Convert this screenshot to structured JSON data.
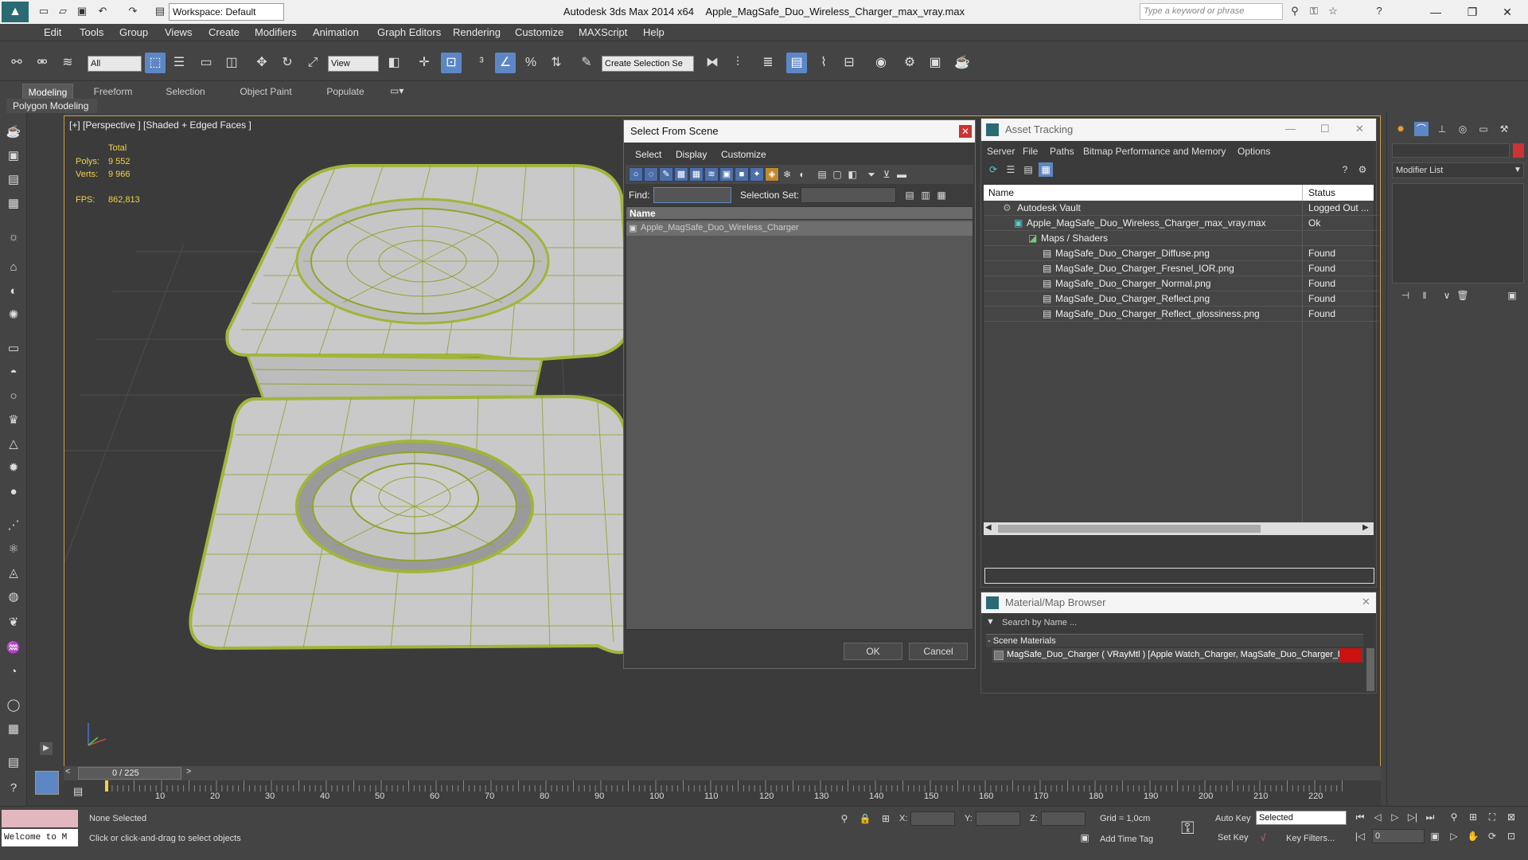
{
  "titlebar": {
    "app": "Autodesk 3ds Max  2014 x64",
    "file": "Apple_MagSafe_Duo_Wireless_Charger_max_vray.max",
    "workspace": "Workspace: Default",
    "search_placeholder": "Type a keyword or phrase"
  },
  "menu": [
    "Edit",
    "Tools",
    "Group",
    "Views",
    "Create",
    "Modifiers",
    "Animation",
    "Graph Editors",
    "Rendering",
    "Customize",
    "MAXScript",
    "Help"
  ],
  "toolbar": {
    "filter": "All",
    "refcoord": "View",
    "selection_set": "Create Selection Se"
  },
  "ribbon": {
    "tabs": [
      "Modeling",
      "Freeform",
      "Selection",
      "Object Paint",
      "Populate"
    ],
    "panel": "Polygon Modeling"
  },
  "viewport": {
    "label": "[+] [Perspective ] [Shaded + Edged Faces ]",
    "total_label": "Total",
    "polys_label": "Polys:",
    "polys": "9 552",
    "verts_label": "Verts:",
    "verts": "9 966",
    "fps_label": "FPS:",
    "fps": "862,813"
  },
  "select_from_scene": {
    "title": "Select From Scene",
    "menus": [
      "Select",
      "Display",
      "Customize"
    ],
    "find_label": "Find:",
    "selection_set_label": "Selection Set:",
    "column_name": "Name",
    "item": "Apple_MagSafe_Duo_Wireless_Charger",
    "ok": "OK",
    "cancel": "Cancel"
  },
  "asset_tracking": {
    "title": "Asset Tracking",
    "menus": [
      "Server",
      "File",
      "Paths",
      "Bitmap Performance and Memory",
      "Options"
    ],
    "col_name": "Name",
    "col_status": "Status",
    "rows": [
      {
        "name": "Autodesk Vault",
        "status": "Logged Out ..."
      },
      {
        "name": "Apple_MagSafe_Duo_Wireless_Charger_max_vray.max",
        "status": "Ok"
      },
      {
        "name": "Maps / Shaders",
        "status": ""
      },
      {
        "name": "MagSafe_Duo_Charger_Diffuse.png",
        "status": "Found"
      },
      {
        "name": "MagSafe_Duo_Charger_Fresnel_IOR.png",
        "status": "Found"
      },
      {
        "name": "MagSafe_Duo_Charger_Normal.png",
        "status": "Found"
      },
      {
        "name": "MagSafe_Duo_Charger_Reflect.png",
        "status": "Found"
      },
      {
        "name": "MagSafe_Duo_Charger_Reflect_glossiness.png",
        "status": "Found"
      }
    ]
  },
  "material_browser": {
    "title": "Material/Map Browser",
    "search_placeholder": "Search by Name ...",
    "group": "- Scene Materials",
    "material": "MagSafe_Duo_Charger  ( VRayMtl ) [Apple Watch_Charger, MagSafe_Duo_Charger_b..."
  },
  "command_panel": {
    "modifier_list": "Modifier List"
  },
  "timeline": {
    "frame": "0 / 225",
    "ticks": [
      "10",
      "20",
      "30",
      "40",
      "50",
      "60",
      "70",
      "80",
      "90",
      "100",
      "110",
      "120",
      "130",
      "140",
      "150",
      "160",
      "170",
      "180",
      "190",
      "200",
      "210",
      "220"
    ]
  },
  "status": {
    "maxscript": "Welcome to M",
    "selection": "None Selected",
    "prompt": "Click or click-and-drag to select objects",
    "x_label": "X:",
    "y_label": "Y:",
    "z_label": "Z:",
    "grid": "Grid = 1,0cm",
    "add_time_tag": "Add Time Tag",
    "auto_key": "Auto Key",
    "set_key": "Set Key",
    "selected": "Selected",
    "key_filters": "Key Filters...",
    "frame_value": "0"
  }
}
